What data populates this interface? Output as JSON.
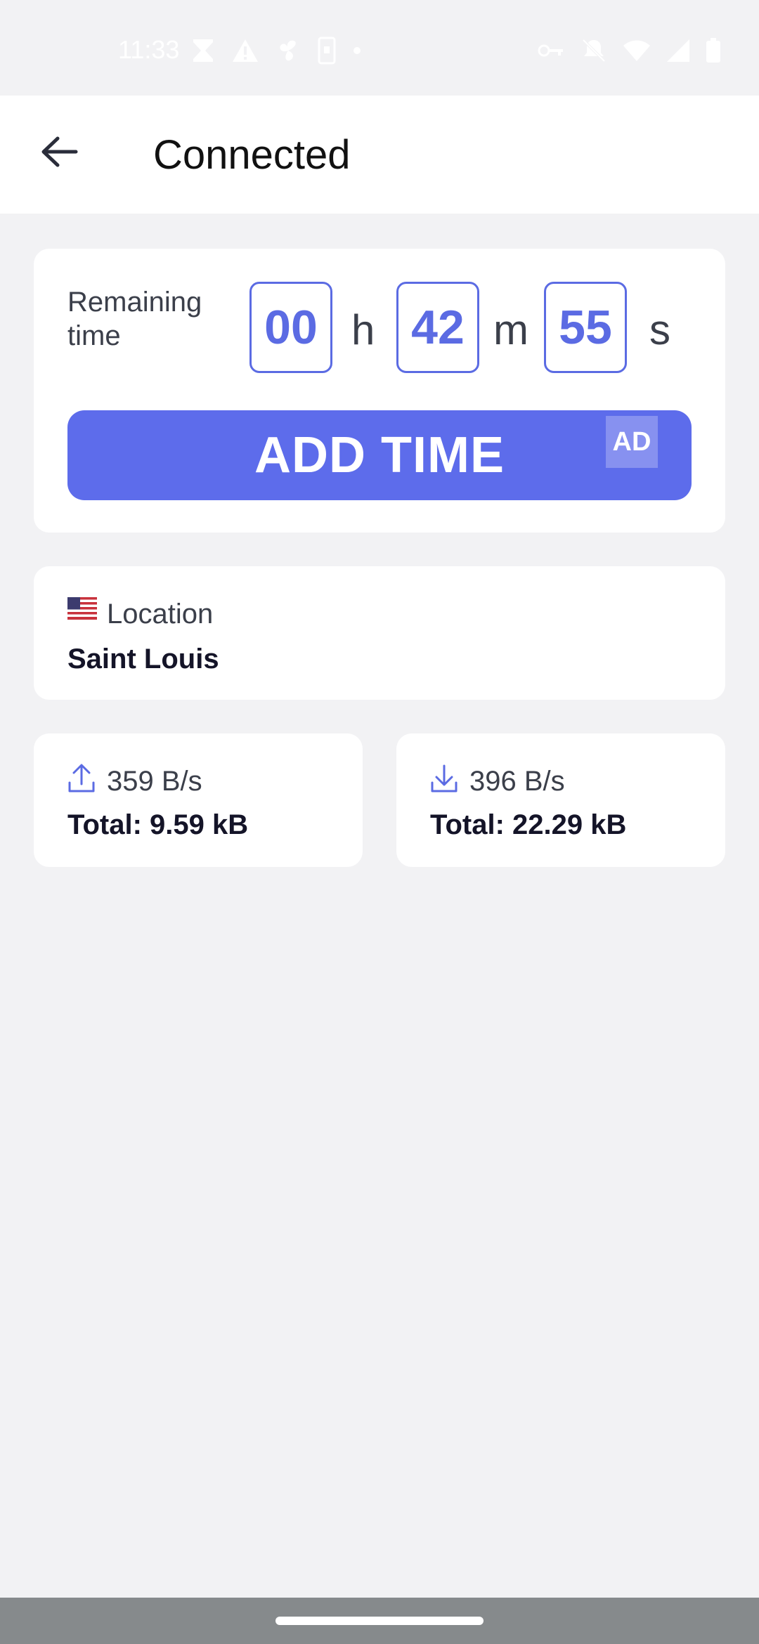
{
  "status_bar": {
    "time": "11:33",
    "icons": [
      "hourglass-icon",
      "warning-icon",
      "fan-icon",
      "phone-icon",
      "dot-icon",
      "vpn-key-icon",
      "vibrate-off-icon",
      "wifi-icon",
      "signal-icon",
      "battery-icon"
    ]
  },
  "header": {
    "title": "Connected"
  },
  "timer": {
    "label": "Remaining time",
    "hours": "00",
    "hours_unit": "h",
    "minutes": "42",
    "minutes_unit": "m",
    "seconds": "55",
    "seconds_unit": "s",
    "add_time_label": "ADD TIME",
    "ad_badge": "AD"
  },
  "location": {
    "label": "Location",
    "value": "Saint Louis",
    "flag": "us-flag-icon"
  },
  "upload": {
    "rate": "359 B/s",
    "total": "Total: 9.59 kB",
    "icon": "upload-icon"
  },
  "download": {
    "rate": "396 B/s",
    "total": "Total: 22.29 kB",
    "icon": "download-icon"
  },
  "colors": {
    "accent": "#5d6ceb",
    "background": "#f2f2f4",
    "card": "#ffffff"
  }
}
